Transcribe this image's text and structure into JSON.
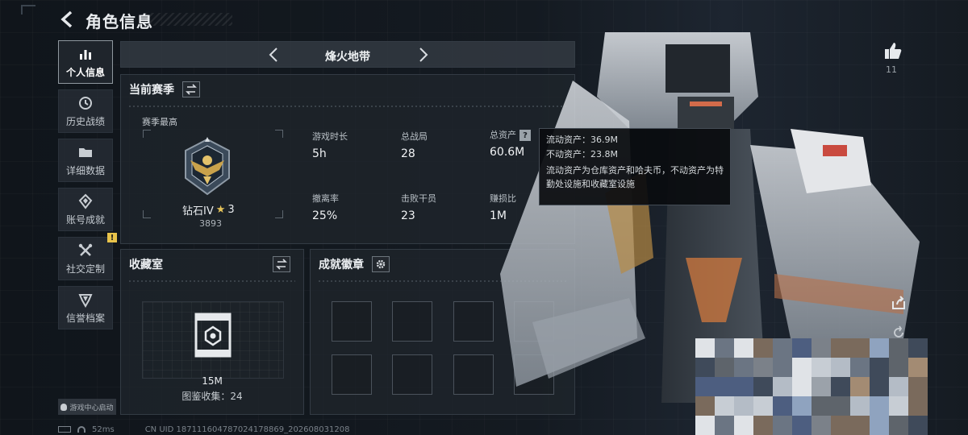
{
  "header": {
    "title": "角色信息"
  },
  "sidebar": {
    "items": [
      {
        "label": "个人信息"
      },
      {
        "label": "历史战绩"
      },
      {
        "label": "详细数据"
      },
      {
        "label": "账号成就"
      },
      {
        "label": "社交定制",
        "badge": "!"
      },
      {
        "label": "信誉档案"
      }
    ]
  },
  "mode": {
    "name": "烽火地带"
  },
  "season": {
    "title": "当前赛季",
    "best_label": "赛季最高",
    "rank_name": "钻石IV",
    "rank_star": "★",
    "rank_stars": "3",
    "rank_score": "3893",
    "stats": [
      {
        "key": "游戏时长",
        "value": "5h"
      },
      {
        "key": "总战局",
        "value": "28"
      },
      {
        "key": "总资产",
        "value": "60.6M",
        "help": "?"
      },
      {
        "key": "撤离率",
        "value": "25%"
      },
      {
        "key": "击败干员",
        "value": "23"
      },
      {
        "key": "赚损比",
        "value": "1M"
      }
    ]
  },
  "tooltip": {
    "line1": "流动资产：36.9M",
    "line2": "不动资产：23.8M",
    "desc": "流动资产为仓库资产和哈夫币，不动资产为特勤处设施和收藏室设施"
  },
  "collection": {
    "title": "收藏室",
    "value": "15M",
    "count": "图鉴收集：24"
  },
  "badges": {
    "title": "成就徽章"
  },
  "like": {
    "count": "11"
  },
  "footer": {
    "game_center": "游戏中心启动",
    "ping": "52ms",
    "uid": "CN UID 187111604787024178869_202608031208"
  },
  "colors": {
    "accent_gold": "#e7c45a",
    "panel_bg": "#1f252c",
    "warning": "#e8c34a"
  }
}
